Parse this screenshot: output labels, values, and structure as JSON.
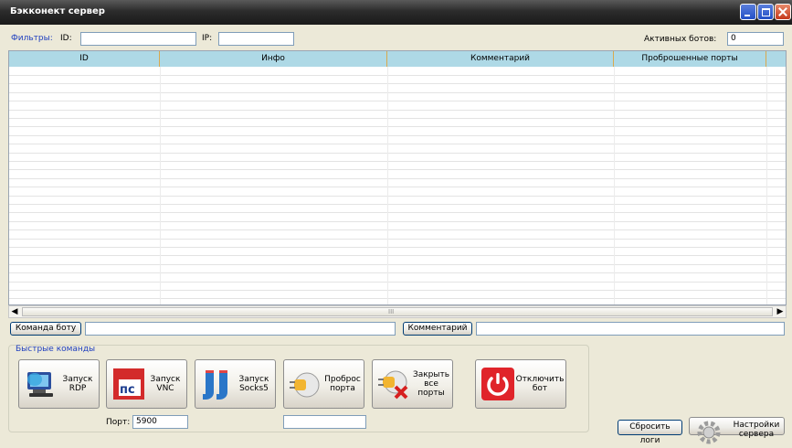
{
  "window": {
    "title": "Бэкконект сервер"
  },
  "filters": {
    "label": "Фильтры:",
    "id_label": "ID:",
    "id_value": "",
    "ip_label": "IP:",
    "ip_value": "",
    "active_bots_label": "Активных ботов:",
    "active_bots_value": "0"
  },
  "table": {
    "columns": [
      "ID",
      "Инфо",
      "Комментарий",
      "Проброшенные порты"
    ],
    "rows": []
  },
  "scrollbar": {
    "thumb_grip": "III"
  },
  "command": {
    "send_label": "Команда боту",
    "command_value": "",
    "comment_label": "Комментарий",
    "comment_value": ""
  },
  "quick": {
    "title": "Быстрые команды",
    "buttons": [
      {
        "label": "Запуск RDP",
        "icon": "rdp-computer-icon"
      },
      {
        "label": "Запуск VNC",
        "icon": "vnc-logo-icon"
      },
      {
        "label": "Запуск Socks5",
        "icon": "socks-icon"
      },
      {
        "label": "Проброс порта",
        "icon": "plug-icon"
      },
      {
        "label": "Закрыть все порты",
        "icon": "plug-close-icon"
      },
      {
        "label": "Отключить бот",
        "icon": "power-icon"
      }
    ],
    "port_label": "Порт:",
    "port_value": "5900",
    "extra_value": ""
  },
  "actions": {
    "reset_logs_label": "Сбросить логи",
    "settings_label": "Настройки сервера"
  },
  "colors": {
    "header": "#aed9e6",
    "power": "#e0242a",
    "link": "#1f3fbf"
  }
}
